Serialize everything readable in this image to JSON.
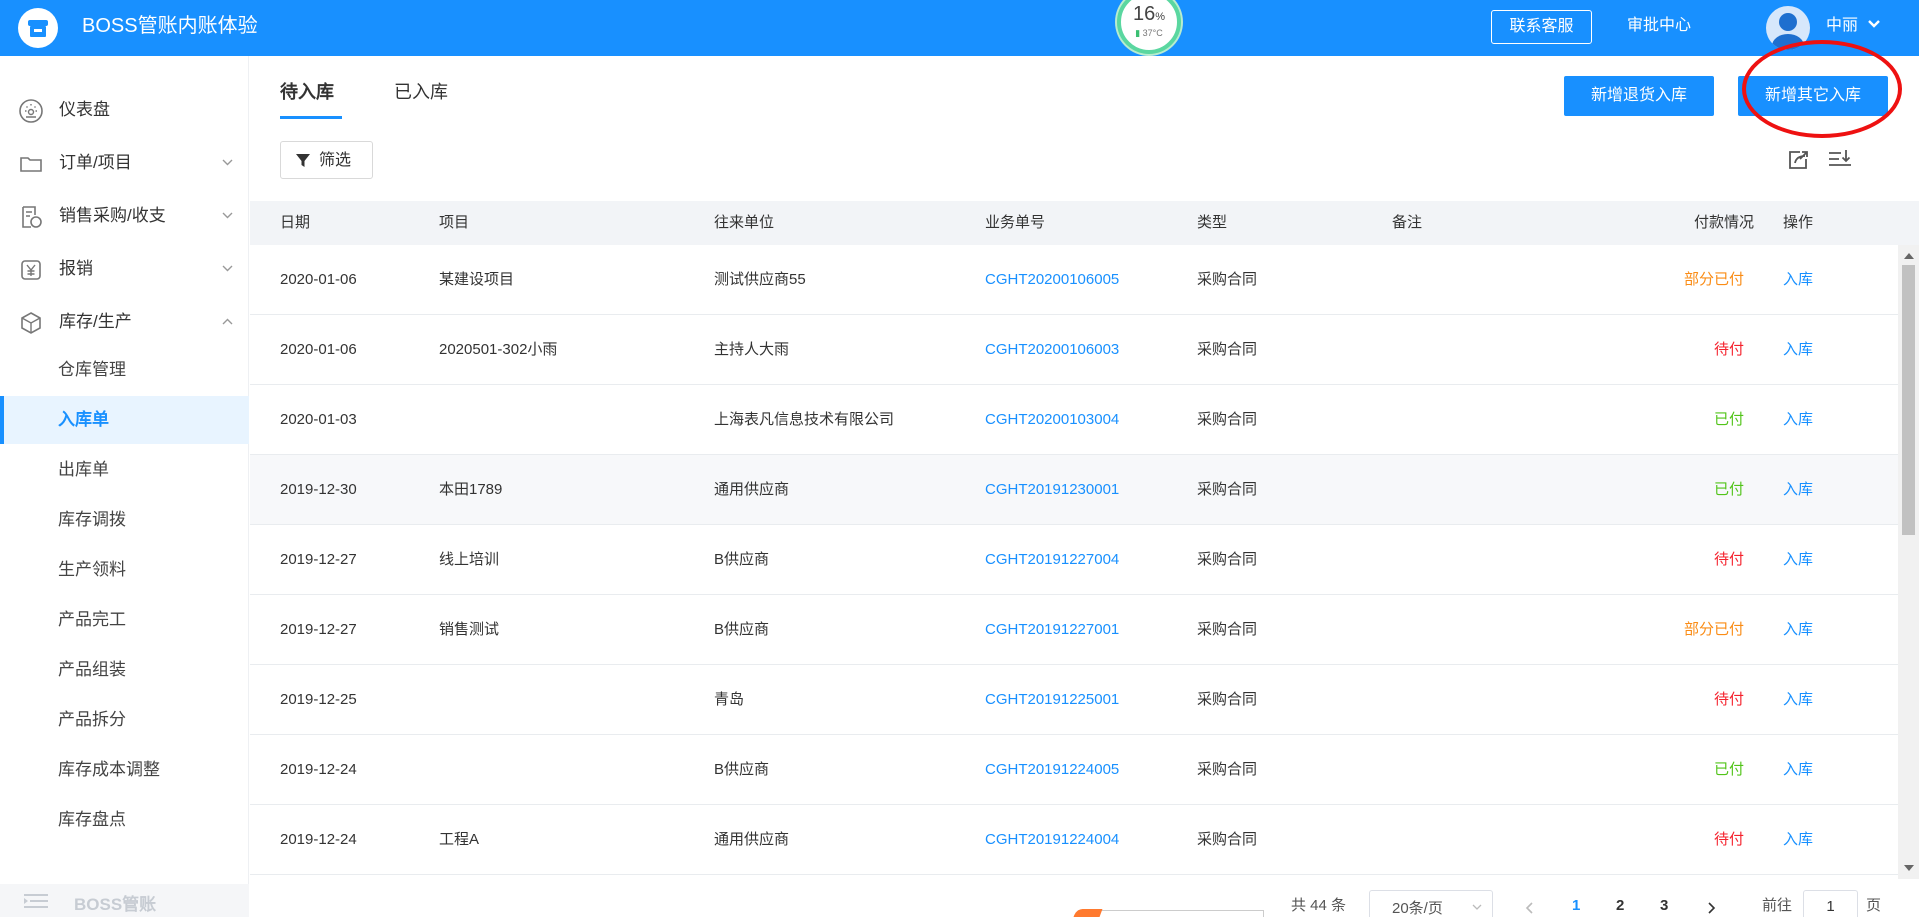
{
  "header": {
    "app_title": "BOSS管账内账体验",
    "gauge_value": "16",
    "gauge_unit": "%",
    "gauge_temp": "37°C",
    "contact_label": "联系客服",
    "approval_label": "审批中心",
    "username": "中丽"
  },
  "sidebar": {
    "groups": [
      {
        "label": "仪表盘",
        "icon": "dashboard-icon"
      },
      {
        "label": "订单/项目",
        "icon": "folder-icon"
      },
      {
        "label": "销售采购/收支",
        "icon": "invoice-icon"
      },
      {
        "label": "报销",
        "icon": "yen-icon"
      },
      {
        "label": "库存/生产",
        "icon": "box-icon"
      }
    ],
    "sub_items": [
      "仓库管理",
      "入库单",
      "出库单",
      "库存调拨",
      "生产领料",
      "产品完工",
      "产品组装",
      "产品拆分",
      "库存成本调整",
      "库存盘点"
    ],
    "active_sub": "入库单",
    "collapse_label": "BOSS管账"
  },
  "main": {
    "tabs": [
      "待入库",
      "已入库"
    ],
    "active_tab": "待入库",
    "btn_return": "新增退货入库",
    "btn_other": "新增其它入库",
    "filter_label": "筛选",
    "columns": [
      "日期",
      "项目",
      "往来单位",
      "业务单号",
      "类型",
      "备注",
      "付款情况",
      "操作"
    ],
    "rows": [
      {
        "date": "2020-01-06",
        "project": "某建设项目",
        "partner": "测试供应商55",
        "order": "CGHT20200106005",
        "type": "采购合同",
        "note": "",
        "pay": "部分已付",
        "action": "入库"
      },
      {
        "date": "2020-01-06",
        "project": "2020501-302小雨",
        "partner": "主持人大雨",
        "order": "CGHT20200106003",
        "type": "采购合同",
        "note": "",
        "pay": "待付",
        "action": "入库"
      },
      {
        "date": "2020-01-03",
        "project": "",
        "partner": "上海表凡信息技术有限公司",
        "order": "CGHT20200103004",
        "type": "采购合同",
        "note": "",
        "pay": "已付",
        "action": "入库"
      },
      {
        "date": "2019-12-30",
        "project": "本田1789",
        "partner": "通用供应商",
        "order": "CGHT20191230001",
        "type": "采购合同",
        "note": "",
        "pay": "已付",
        "action": "入库"
      },
      {
        "date": "2019-12-27",
        "project": "线上培训",
        "partner": "B供应商",
        "order": "CGHT20191227004",
        "type": "采购合同",
        "note": "",
        "pay": "待付",
        "action": "入库"
      },
      {
        "date": "2019-12-27",
        "project": "销售测试",
        "partner": "B供应商",
        "order": "CGHT20191227001",
        "type": "采购合同",
        "note": "",
        "pay": "部分已付",
        "action": "入库"
      },
      {
        "date": "2019-12-25",
        "project": "",
        "partner": "青岛",
        "order": "CGHT20191225001",
        "type": "采购合同",
        "note": "",
        "pay": "待付",
        "action": "入库"
      },
      {
        "date": "2019-12-24",
        "project": "",
        "partner": "B供应商",
        "order": "CGHT20191224005",
        "type": "采购合同",
        "note": "",
        "pay": "已付",
        "action": "入库"
      },
      {
        "date": "2019-12-24",
        "project": "工程A",
        "partner": "通用供应商",
        "order": "CGHT20191224004",
        "type": "采购合同",
        "note": "",
        "pay": "待付",
        "action": "入库"
      }
    ],
    "pay_colors": {
      "部分已付": "#fa8c16",
      "待付": "#f5222d",
      "已付": "#52c41a"
    }
  },
  "pagination": {
    "total": "共 44 条",
    "page_size": "20条/页",
    "pages": [
      "1",
      "2",
      "3"
    ],
    "current": "1",
    "goto_prefix": "前往",
    "goto_value": "1",
    "goto_suffix": "页"
  },
  "colors": {
    "accent": "#1890ff",
    "annotation": "#ee1111"
  }
}
